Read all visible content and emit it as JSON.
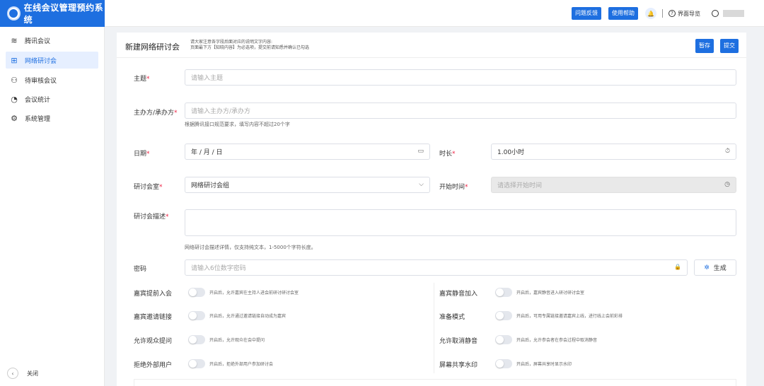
{
  "app": {
    "title": "在线会议管理预约系统"
  },
  "topbar": {
    "feedback": "问题反馈",
    "help": "使用帮助",
    "guide_icon": "?",
    "guide": "界面导览"
  },
  "sidebar": {
    "items": [
      {
        "icon": "≋",
        "label": "腾讯会议"
      },
      {
        "icon": "⊞",
        "label": "网络研讨会"
      },
      {
        "icon": "⚇",
        "label": "待审核会议"
      },
      {
        "icon": "◔",
        "label": "会议统计"
      },
      {
        "icon": "⚙",
        "label": "系统管理"
      }
    ],
    "active_index": 1,
    "collapse_icon": "‹",
    "collapse_label": "关闭"
  },
  "page": {
    "title": "新建网络研讨会",
    "hint_line1": "请大家注意各字段后面对应的说明文字内容:",
    "hint_line2": "页面最下方【知晓内容】为必选项，提交前请知悉并确认已勾选",
    "save_label": "暂存",
    "submit_label": "提交"
  },
  "form": {
    "subject": {
      "label": "主题",
      "placeholder": "请输入主题"
    },
    "organizer": {
      "label": "主办方/承办方",
      "placeholder": "请输入主办方/承办方",
      "help": "根据腾讯接口规范要求，填写内容不超过20个字"
    },
    "date": {
      "label": "日期",
      "value": "年 / 月 / 日",
      "icon": "▭"
    },
    "duration": {
      "label": "时长",
      "value": "1.00小时",
      "icon": "⏱"
    },
    "room": {
      "label": "研讨会室",
      "value": "网络研讨会组",
      "icon": "⌵"
    },
    "start_time": {
      "label": "开始时间",
      "placeholder": "请选择开始时间",
      "icon": "◷"
    },
    "description": {
      "label": "研讨会描述",
      "help": "网络研讨会描述详情，仅支持纯文本，1-5000个字符长度。"
    },
    "password": {
      "label": "密码",
      "placeholder": "请输入6位数字密码",
      "lock_icon": "🔒",
      "generate_icon": "✲",
      "generate_label": "生成"
    },
    "toggles": [
      {
        "label": "嘉宾提前入会",
        "desc": "开启后，允许嘉宾在主持人进会前研讨研讨会室",
        "enabled": false
      },
      {
        "label": "嘉宾静音加入",
        "desc": "开启后，嘉宾静音进入研讨研讨会室",
        "enabled": false
      },
      {
        "label": "嘉宾邀请链接",
        "desc": "开启后，允许通过邀请链接自动成为嘉宾",
        "enabled": false
      },
      {
        "label": "准备模式",
        "desc": "开启后，可用专属链接邀请嘉宾上线，进行线上会前彩排",
        "enabled": false
      },
      {
        "label": "允许观众提问",
        "desc": "开启后，允许观众在会中提问",
        "enabled": false
      },
      {
        "label": "允许取消静音",
        "desc": "开启后，允许参会者在参会过程中取消静音",
        "enabled": false
      },
      {
        "label": "拒绝外部用户",
        "desc": "开启后，拒绝外部用户参加研讨会",
        "enabled": false
      },
      {
        "label": "屏幕共享水印",
        "desc": "开启后，屏幕共享时显示水印",
        "enabled": false
      }
    ]
  },
  "colors": {
    "accent": "#1e6fe0",
    "required": "#ee2244"
  }
}
